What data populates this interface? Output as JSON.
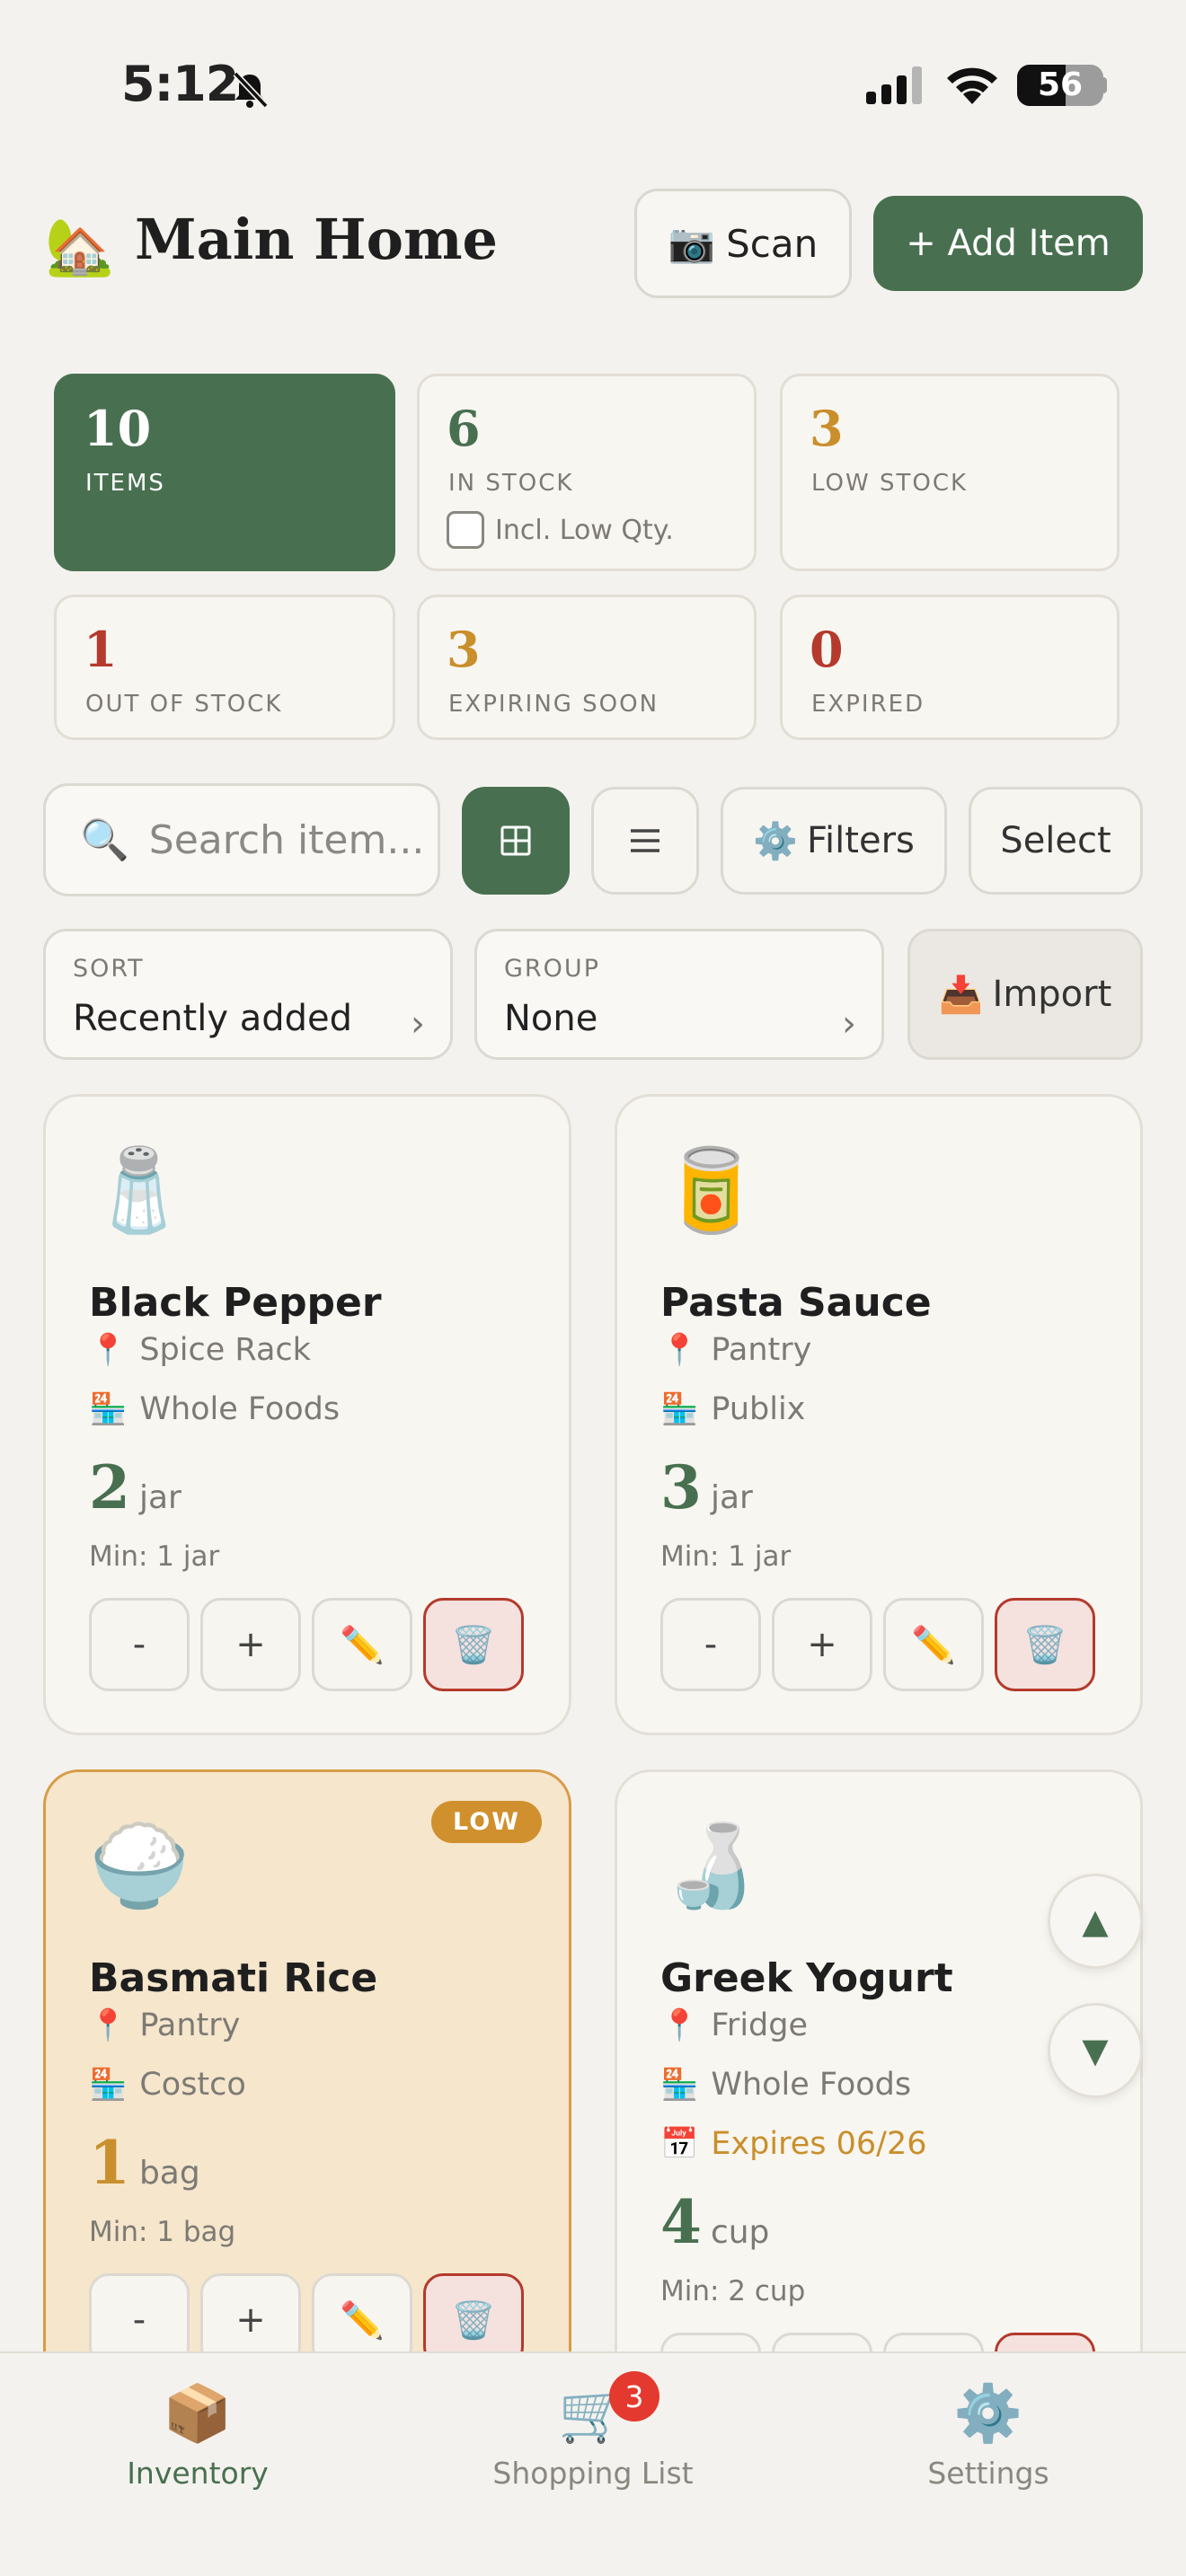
{
  "status_bar": {
    "time": "5:12",
    "battery": "56",
    "battery_level": 0.56
  },
  "header": {
    "home_icon": "🏡",
    "title": "Main Home",
    "scan_icon": "📷",
    "scan_label": "Scan",
    "add_label": "+ Add Item"
  },
  "stats": {
    "items": {
      "value": "10",
      "label": "ITEMS"
    },
    "in_stock": {
      "value": "6",
      "label": "IN STOCK",
      "checkbox_label": "Incl. Low Qty.",
      "checked": false
    },
    "low_stock": {
      "value": "3",
      "label": "LOW STOCK"
    },
    "out_of_stock": {
      "value": "1",
      "label": "OUT OF STOCK"
    },
    "expiring_soon": {
      "value": "3",
      "label": "EXPIRING SOON"
    },
    "expired": {
      "value": "0",
      "label": "EXPIRED"
    }
  },
  "toolbar": {
    "search_icon": "🔍",
    "search_placeholder": "Search item...",
    "filters_icon": "⚙️",
    "filters_label": "Filters",
    "select_label": "Select"
  },
  "sort": {
    "label": "SORT",
    "value": "Recently added"
  },
  "group": {
    "label": "GROUP",
    "value": "None"
  },
  "import": {
    "icon": "📥",
    "label": "Import"
  },
  "items": [
    {
      "emoji": "🧂",
      "name": "Black Pepper",
      "location": "Spice Rack",
      "store": "Whole Foods",
      "qty": "2",
      "unit": "jar",
      "min": "Min: 1 jar"
    },
    {
      "emoji": "🥫",
      "name": "Pasta Sauce",
      "location": "Pantry",
      "store": "Publix",
      "qty": "3",
      "unit": "jar",
      "min": "Min: 1 jar"
    },
    {
      "emoji": "🍚",
      "name": "Basmati Rice",
      "location": "Pantry",
      "store": "Costco",
      "qty": "1",
      "unit": "bag",
      "min": "Min: 1 bag",
      "badge": "LOW"
    },
    {
      "emoji": "🍶",
      "name": "Greek Yogurt",
      "location": "Fridge",
      "store": "Whole Foods",
      "expires": "Expires 06/26",
      "qty": "4",
      "unit": "cup",
      "min": "Min: 2 cup"
    }
  ],
  "card_icons": {
    "location": "📍",
    "store": "🏪",
    "expires": "📅",
    "edit": "✏️",
    "delete": "🗑️",
    "minus": "-",
    "plus": "+"
  },
  "scroll": {
    "up": "▲",
    "down": "▼"
  },
  "tabbar": {
    "inventory": {
      "icon": "📦",
      "label": "Inventory"
    },
    "shopping": {
      "icon": "🛒",
      "label": "Shopping List",
      "badge": "3"
    },
    "settings": {
      "icon": "⚙️",
      "label": "Settings"
    }
  },
  "colors": {
    "accent": "#487050",
    "low": "#c98f2c",
    "danger": "#b33a2c",
    "background": "#f4f2ee"
  }
}
